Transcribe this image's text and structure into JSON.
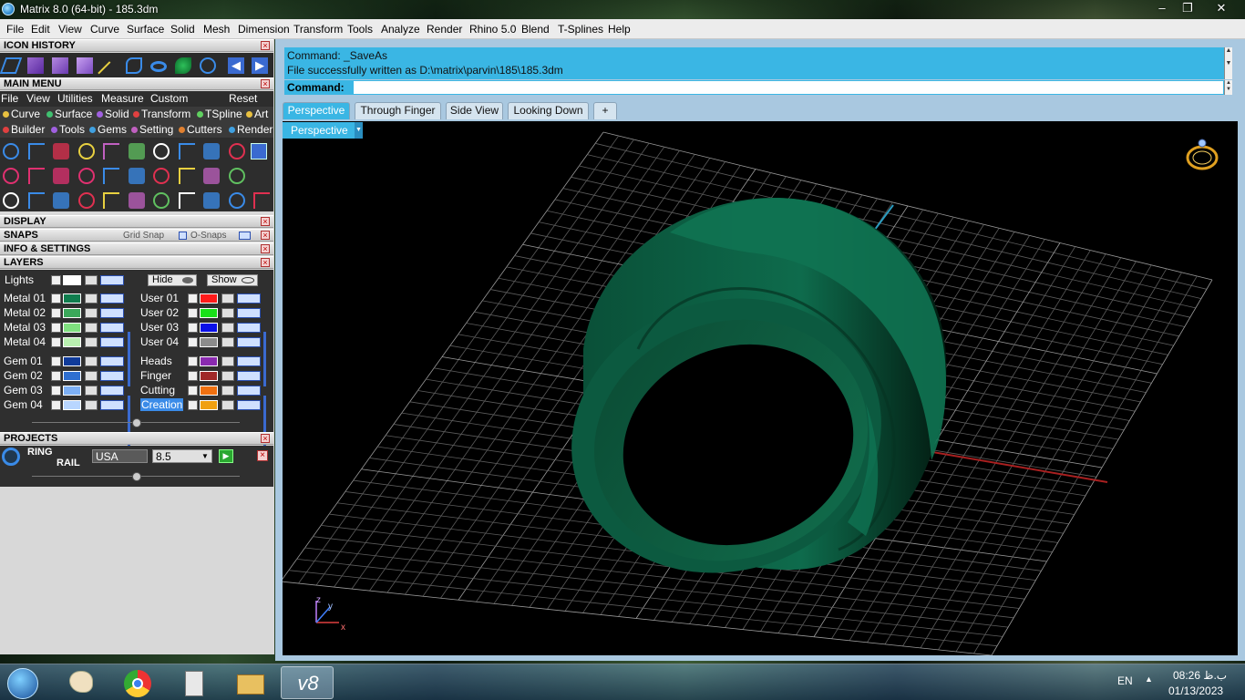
{
  "window": {
    "title": "Matrix 8.0 (64-bit) - 185.3dm",
    "controls": [
      "–",
      "❐",
      "✕"
    ]
  },
  "menubar": [
    "File",
    "Edit",
    "View",
    "Curve",
    "Surface",
    "Solid",
    "Mesh",
    "Dimension",
    "Transform",
    "Tools",
    "Analyze",
    "Render",
    "Rhino 5.0",
    "Blend",
    "T-Splines",
    "Help"
  ],
  "panels": {
    "icon_history": "ICON HISTORY",
    "main_menu": "MAIN MENU",
    "display": "DISPLAY",
    "snaps": "SNAPS",
    "info": "INFO & SETTINGS",
    "layers": "LAYERS",
    "projects": "PROJECTS"
  },
  "main_menu_bar": [
    "File",
    "View",
    "Utilities",
    "Measure",
    "Custom"
  ],
  "main_menu_reset": "Reset",
  "category_row1": [
    {
      "label": "Curve",
      "color": "#e8c040"
    },
    {
      "label": "Surface",
      "color": "#40c070"
    },
    {
      "label": "Solid",
      "color": "#a060e0"
    },
    {
      "label": "Transform",
      "color": "#e04040"
    },
    {
      "label": "TSpline",
      "color": "#60d060"
    },
    {
      "label": "Art",
      "color": "#e8c040"
    }
  ],
  "category_row2": [
    {
      "label": "Builder",
      "color": "#e04040"
    },
    {
      "label": "Tools",
      "color": "#a060e0"
    },
    {
      "label": "Gems",
      "color": "#40a0e0"
    },
    {
      "label": "Setting",
      "color": "#c060c0"
    },
    {
      "label": "Cutters",
      "color": "#e08030"
    },
    {
      "label": "Render",
      "color": "#40a0e0"
    }
  ],
  "snaps": {
    "grid": "Grid Snap",
    "osnaps": "O-Snaps"
  },
  "layers": {
    "lights": "Lights",
    "hide": "Hide",
    "show": "Show",
    "left": [
      {
        "name": "Metal 01",
        "color": "#0f7d4e"
      },
      {
        "name": "Metal 02",
        "color": "#3aa85a"
      },
      {
        "name": "Metal 03",
        "color": "#7fe07f"
      },
      {
        "name": "Metal 04",
        "color": "#b9f0b0"
      },
      {
        "name": "Gem 01",
        "color": "#103b9a"
      },
      {
        "name": "Gem 02",
        "color": "#2f6fd0"
      },
      {
        "name": "Gem 03",
        "color": "#7db0f5"
      },
      {
        "name": "Gem 04",
        "color": "#b8d6ff"
      }
    ],
    "right": [
      {
        "name": "User 01",
        "color": "#ff1a1a"
      },
      {
        "name": "User 02",
        "color": "#1ae01a"
      },
      {
        "name": "User 03",
        "color": "#0a10e8"
      },
      {
        "name": "User 04",
        "color": "#8c8c8c"
      },
      {
        "name": "Heads",
        "color": "#8a2ab0"
      },
      {
        "name": "Finger",
        "color": "#a02828"
      },
      {
        "name": "Cutting",
        "color": "#f07010"
      },
      {
        "name": "Creation",
        "color": "#f0a010"
      }
    ]
  },
  "projects": {
    "name_line1": "RING",
    "name_line2": "RAIL",
    "standard": "USA",
    "size": "8.5"
  },
  "command": {
    "line1": "Command: _SaveAs",
    "line2": "File successfully written as D:\\matrix\\parvin\\185\\185.3dm",
    "prompt": "Command:"
  },
  "tabs": [
    "Perspective",
    "Through Finger",
    "Side View",
    "Looking Down",
    "+"
  ],
  "viewport": {
    "label": "Perspective",
    "ring_color": "#0e6b4c",
    "axis_labels": [
      "z",
      "y",
      "x"
    ]
  },
  "taskbar": {
    "lang": "EN",
    "time": "08:26 ب.ظ",
    "date": "01/13/2023"
  }
}
